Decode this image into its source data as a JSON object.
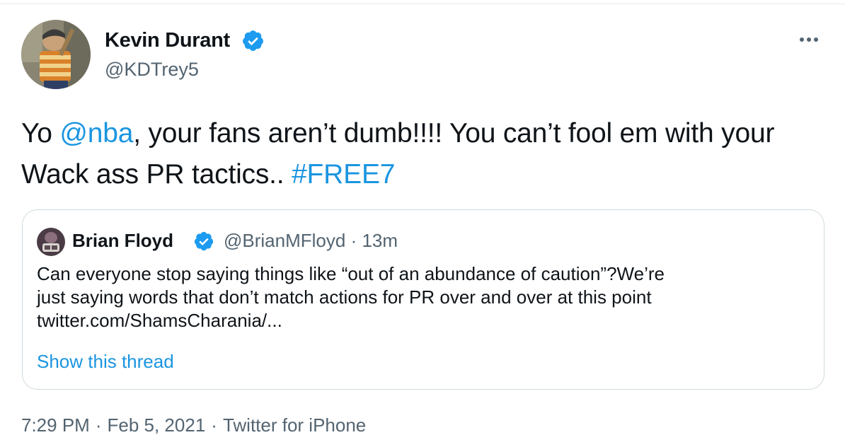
{
  "tweet": {
    "author": {
      "name": "Kevin Durant",
      "handle": "@KDTrey5",
      "verified": true,
      "avatar_icon": "profile-photo-icon"
    },
    "more_icon": "more-dots-icon",
    "text": {
      "part1": "Yo ",
      "mention": "@nba",
      "part2": ",  your fans aren’t dumb!!!! You can’t fool em with your Wack ass PR tactics.. ",
      "hashtag": "#FREE7"
    },
    "quote": {
      "author_name": "Brian Floyd",
      "author_handle": "@BrianMFloyd",
      "separator": "·",
      "time": "13m",
      "verified": true,
      "text_lines": [
        "Can everyone stop saying things like “out of an abundance of caution”?We’re",
        "just saying words that don’t match actions for PR over and over at this point",
        "twitter.com/ShamsCharania/..."
      ],
      "show_thread_label": "Show this thread"
    },
    "meta": {
      "time": "7:29 PM",
      "separator": "·",
      "date": "Feb 5, 2021",
      "source": "Twitter for iPhone"
    }
  },
  "colors": {
    "link": "#1b95e0",
    "verified": "#1d9bf0",
    "secondary_text": "#536471",
    "border": "#cfd9de"
  }
}
